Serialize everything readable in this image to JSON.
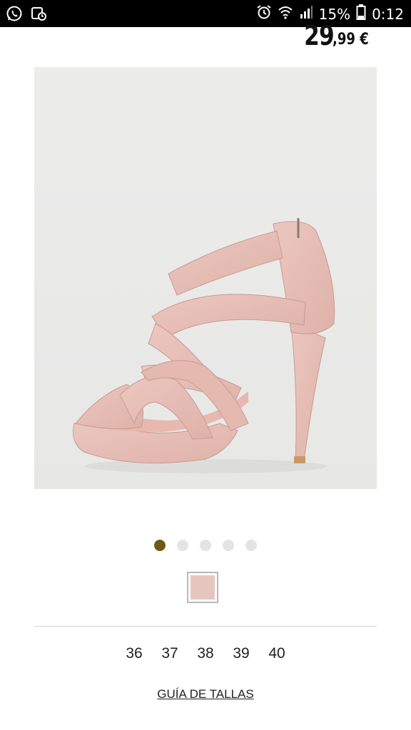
{
  "status_bar": {
    "battery_percent": "15%",
    "time": "0:12",
    "icons": [
      "whatsapp-icon",
      "gallery-icon",
      "alarm-icon",
      "wifi-icon",
      "signal-icon",
      "battery-icon"
    ]
  },
  "product": {
    "price_integer": "29",
    "price_decimal": ",99 €",
    "image_description_icon": "pink-platform-sandal-image"
  },
  "carousel": {
    "total_dots": 5,
    "active_index": 0,
    "active_color": "#6b5a12"
  },
  "sizes": [
    "36",
    "37",
    "38",
    "39",
    "40"
  ],
  "size_guide_label": "GUÍA DE TALLAS"
}
